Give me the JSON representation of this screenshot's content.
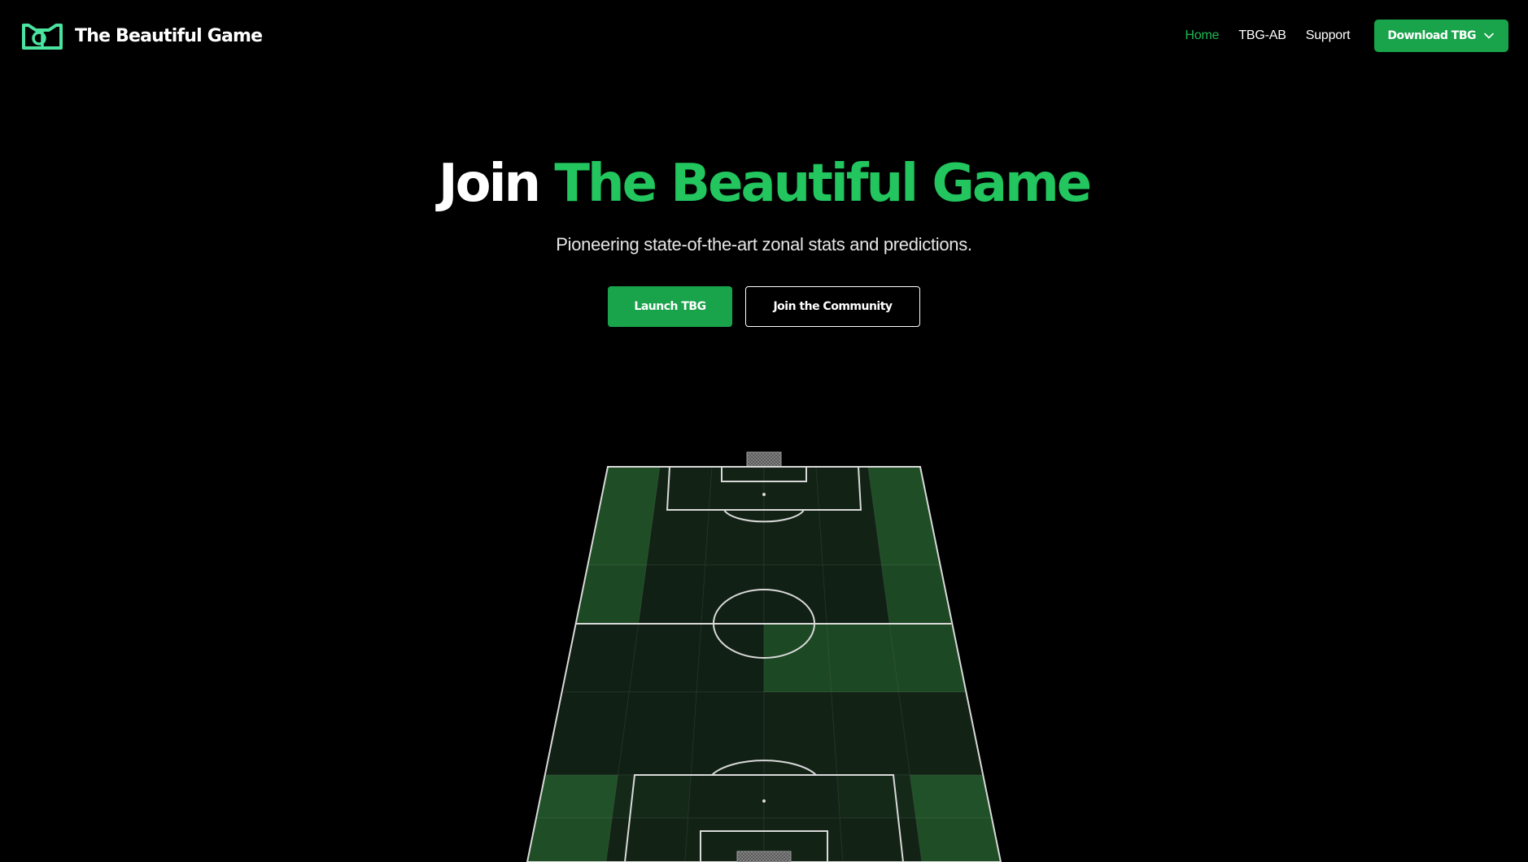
{
  "brand": {
    "name": "The Beautiful Game",
    "logo": "tbg-logo-icon"
  },
  "nav": {
    "items": [
      {
        "label": "Home",
        "active": true
      },
      {
        "label": "TBG-AB",
        "active": false
      },
      {
        "label": "Support",
        "active": false
      }
    ],
    "download_label": "Download TBG",
    "download_icon": "chevron-down-icon"
  },
  "hero": {
    "title_prefix": "Join",
    "title_accent": "The Beautiful Game",
    "subtitle": "Pioneering state-of-the-art zonal stats and predictions.",
    "primary_cta": "Launch TBG",
    "secondary_cta": "Join the Community"
  },
  "pitch": {
    "zone_grid": {
      "columns": 6,
      "rows": 6
    },
    "zone_intensity": [
      [
        0.85,
        0.15,
        0.15,
        0.15,
        0.15,
        0.85
      ],
      [
        0.75,
        0.1,
        0.1,
        0.1,
        0.1,
        0.75
      ],
      [
        0.1,
        0.1,
        0.1,
        0.75,
        0.75,
        0.75
      ],
      [
        0.1,
        0.1,
        0.1,
        0.15,
        0.15,
        0.15
      ],
      [
        0.9,
        0.25,
        0.15,
        0.15,
        0.25,
        0.9
      ],
      [
        0.85,
        0.15,
        0.15,
        0.15,
        0.15,
        0.85
      ]
    ]
  },
  "colors": {
    "background": "#000000",
    "accent": "#22c55e",
    "button_green": "#19a34a",
    "zone_bright": "#22572a",
    "zone_dark": "#0f1a12",
    "pitch_line": "#d9d9d9"
  }
}
